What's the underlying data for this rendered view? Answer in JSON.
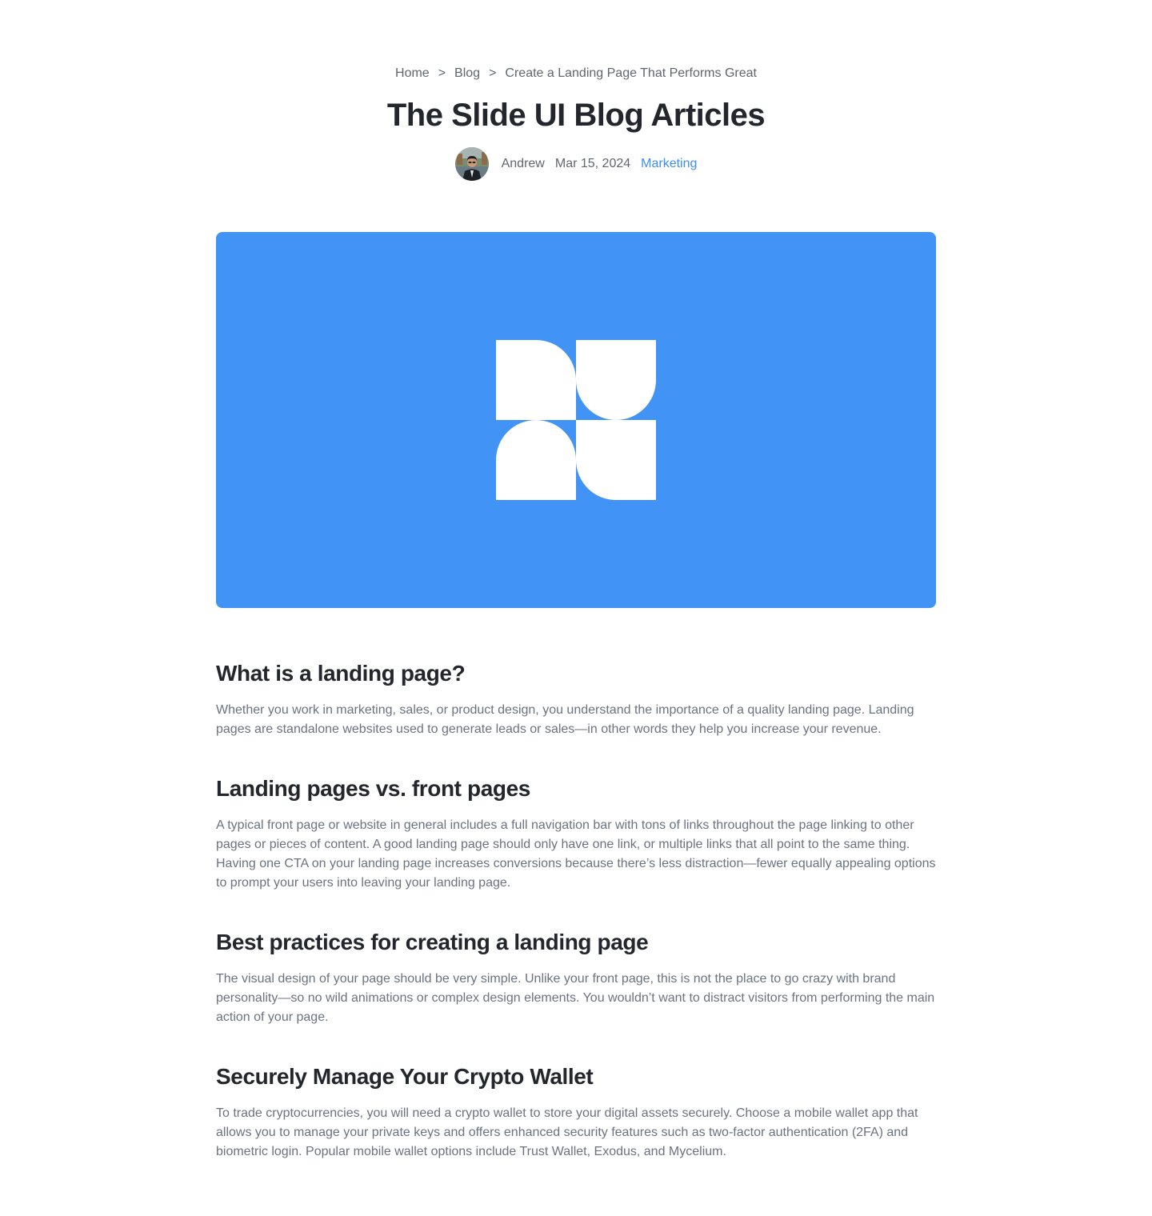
{
  "breadcrumb": {
    "items": [
      "Home",
      "Blog",
      "Create a Landing Page That Performs Great"
    ],
    "separator": ">"
  },
  "article": {
    "title": "The Slide UI Blog Articles",
    "author": "Andrew",
    "date": "Mar 15, 2024",
    "category": "Marketing"
  },
  "hero": {
    "background": "#4193f5",
    "logo_icon": "slide-ui-logo-icon"
  },
  "colors": {
    "accent": "#3d8ef0",
    "heading": "#23272d",
    "body_text": "#6b7280"
  },
  "sections": [
    {
      "heading": "What is a landing page?",
      "body": "Whether you work in marketing, sales, or product design, you understand the importance of a quality landing page. Landing pages are standalone websites used to generate leads or sales—in other words they help you increase your revenue."
    },
    {
      "heading": "Landing pages vs. front pages",
      "body": "A typical front page or website in general includes a full navigation bar with tons of links throughout the page linking to other pages or pieces of content. A good landing page should only have one link, or multiple links that all point to the same thing. Having one CTA on your landing page increases conversions because there’s less distraction—fewer equally appealing options to prompt your users into leaving your landing page."
    },
    {
      "heading": "Best practices for creating a landing page",
      "body": "The visual design of your page should be very simple. Unlike your front page, this is not the place to go crazy with brand personality—so no wild animations or complex design elements. You wouldn’t want to distract visitors from performing the main action of your page."
    },
    {
      "heading": "Securely Manage Your Crypto Wallet",
      "body": "To trade cryptocurrencies, you will need a crypto wallet to store your digital assets securely. Choose a mobile wallet app that allows you to manage your private keys and offers enhanced security features such as two-factor authentication (2FA) and biometric login. Popular mobile wallet options include Trust Wallet, Exodus, and Mycelium."
    }
  ]
}
